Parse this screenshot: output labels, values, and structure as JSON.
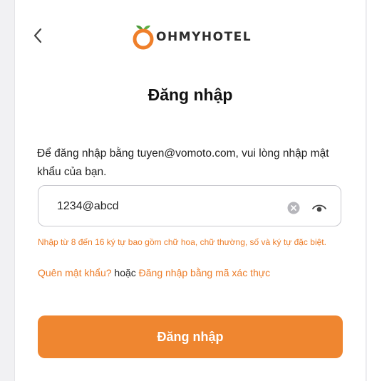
{
  "header": {
    "back_icon": "chevron-left-icon",
    "logo_text": "OHMYHOTEL",
    "logo_icon": "orange-fruit-logo"
  },
  "login": {
    "title": "Đăng nhập",
    "instruction": "Để đăng nhập bằng tuyen@vomoto.com, vui lòng nhập mật khẩu của bạn.",
    "password_value": "1234@abcd",
    "clear_icon": "clear-circle-icon",
    "toggle_visibility_icon": "eye-icon",
    "password_hint": "Nhập từ 8 đến 16 ký tự bao gồm chữ hoa, chữ thường, số và ký tự đặc biệt.",
    "forgot_password_link": "Quên mật khẩu?",
    "or_text": "hoặc",
    "code_login_link": "Đăng nhập bằng mã xác thực",
    "submit_label": "Đăng nhập"
  },
  "colors": {
    "accent": "#ef8630",
    "hint_text": "#ec7b26",
    "logo_green": "#4a9b3a"
  }
}
